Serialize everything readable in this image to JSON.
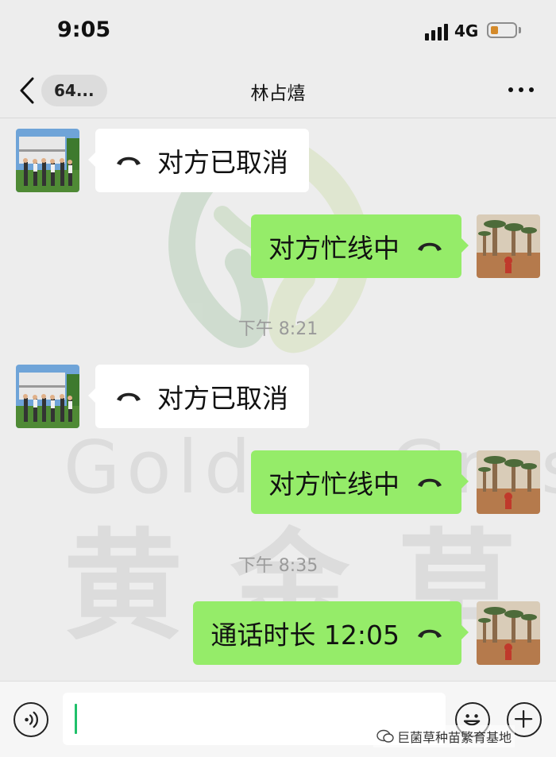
{
  "status_bar": {
    "time": "9:05",
    "network": "4G",
    "battery_level": 0.3
  },
  "nav": {
    "unread_badge": "64...",
    "title": "林占熺",
    "more_icon": "more-icon",
    "back_icon": "chevron-left-icon"
  },
  "messages": [
    {
      "direction": "in",
      "text": "对方已取消",
      "icon": "phone-hangup-icon"
    },
    {
      "direction": "out",
      "text": "对方忙线中",
      "icon": "phone-hangup-icon"
    },
    {
      "timestamp": "下午 8:21"
    },
    {
      "direction": "in",
      "text": "对方已取消",
      "icon": "phone-hangup-icon"
    },
    {
      "direction": "out",
      "text": "对方忙线中",
      "icon": "phone-hangup-icon"
    },
    {
      "timestamp": "下午 8:35"
    },
    {
      "direction": "out",
      "text": "通话时长 12:05",
      "icon": "phone-hangup-icon"
    }
  ],
  "watermark": {
    "latin": "Golden Grass",
    "chinese": "黄金草"
  },
  "input_bar": {
    "voice_icon": "voice-icon",
    "emoji_icon": "emoji-icon",
    "plus_icon": "plus-icon",
    "input_value": ""
  },
  "account_tag": "巨菌草种苗繁育基地",
  "colors": {
    "background": "#ededed",
    "outgoing_bubble": "#95ec69",
    "incoming_bubble": "#ffffff",
    "timestamp": "#9a9a9a"
  }
}
